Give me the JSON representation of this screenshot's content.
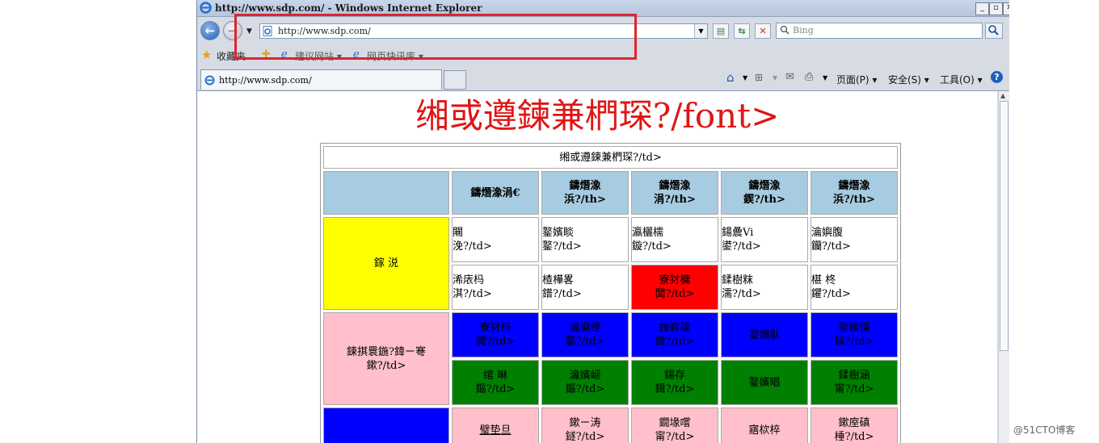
{
  "window": {
    "title": "http://www.sdp.com/ - Windows Internet Explorer",
    "buttons": [
      "_",
      "▫",
      "✕"
    ]
  },
  "addressbar": {
    "url": "http://www.sdp.com/"
  },
  "search": {
    "placeholder": "Bing"
  },
  "favorites": {
    "label": "收藏夹",
    "items": [
      "建议网站 ▾",
      "网页快讯库 ▾"
    ]
  },
  "tab": {
    "title": "http://www.sdp.com/"
  },
  "commands": {
    "page": "页面(P) ▾",
    "safety": "安全(S) ▾",
    "tools": "工具(O) ▾"
  },
  "page": {
    "heading": "缃或遵鍊兼椚琛?/font>",
    "table": {
      "caption": "缃或遵鍊兼椚琛?/td>",
      "headers": [
        "鑄熸潒涓€",
        "鑄熸潒\n浜?/th>",
        "鑄熸潒\n涓?/th>",
        "鑄熸潒\n鍥?/th>",
        "鑄熸潒\n浜?/th>"
      ],
      "groups": [
        {
          "label": "鎵  涚",
          "rows": [
            [
              "闀\n浼?/td>",
              "鐜嬪睒\n鐜?/td>",
              "瀛欐檽\n鏇?/td>",
              "鍚曟Vi\n鍙?/td>",
              "瀹嬩腹\n钄?/td>"
            ],
            [
              "浠庡杩\n淇?/td>",
              "楂樺畧\n鐠?/td>",
              "寮犲槦\n闆?/td>",
              "鍒樹粖\n濡?/td>",
              "椹   柊\n鑺?/td>"
            ]
          ]
        },
        {
          "label": "鍊掑睘鍦?鍏ㄧ弿\n鏉?/td>",
          "rows": [
            [
              "寮犲杩\n闆?/td>",
              "瀹嬩緸\n鐜?/td>",
              "鍏嶈礌\n鍏?/td>",
              "鐜嬭倝",
              "鐜嬪惈\n鑰?/td>"
            ],
            [
              "绾   晽\n鏂?/td>",
              "瀹嬪崡\n鏂?/td>",
              "鍚存\n鍓?/td>",
              "鐜嬪晿",
              "鍒樹涵\n甯?/td>"
            ]
          ]
        },
        {
          "label": "",
          "rows": [
            [
              "璧垫旦",
              "鏉ㄧ涛\n鐩?/td>",
              "鐗堟嚐\n甯?/td>",
              "寤栨椊",
              "鏉庢磌\n棰?/td>"
            ]
          ]
        }
      ]
    }
  },
  "colors": {
    "header_blue": "#a7cbe0",
    "yellow": "#ffff00",
    "red": "#ff0000",
    "blue": "#0000ff",
    "green": "#008000",
    "pink": "#ffc0cb",
    "heading_red": "#e01515"
  },
  "watermark": "@51CTO博客"
}
